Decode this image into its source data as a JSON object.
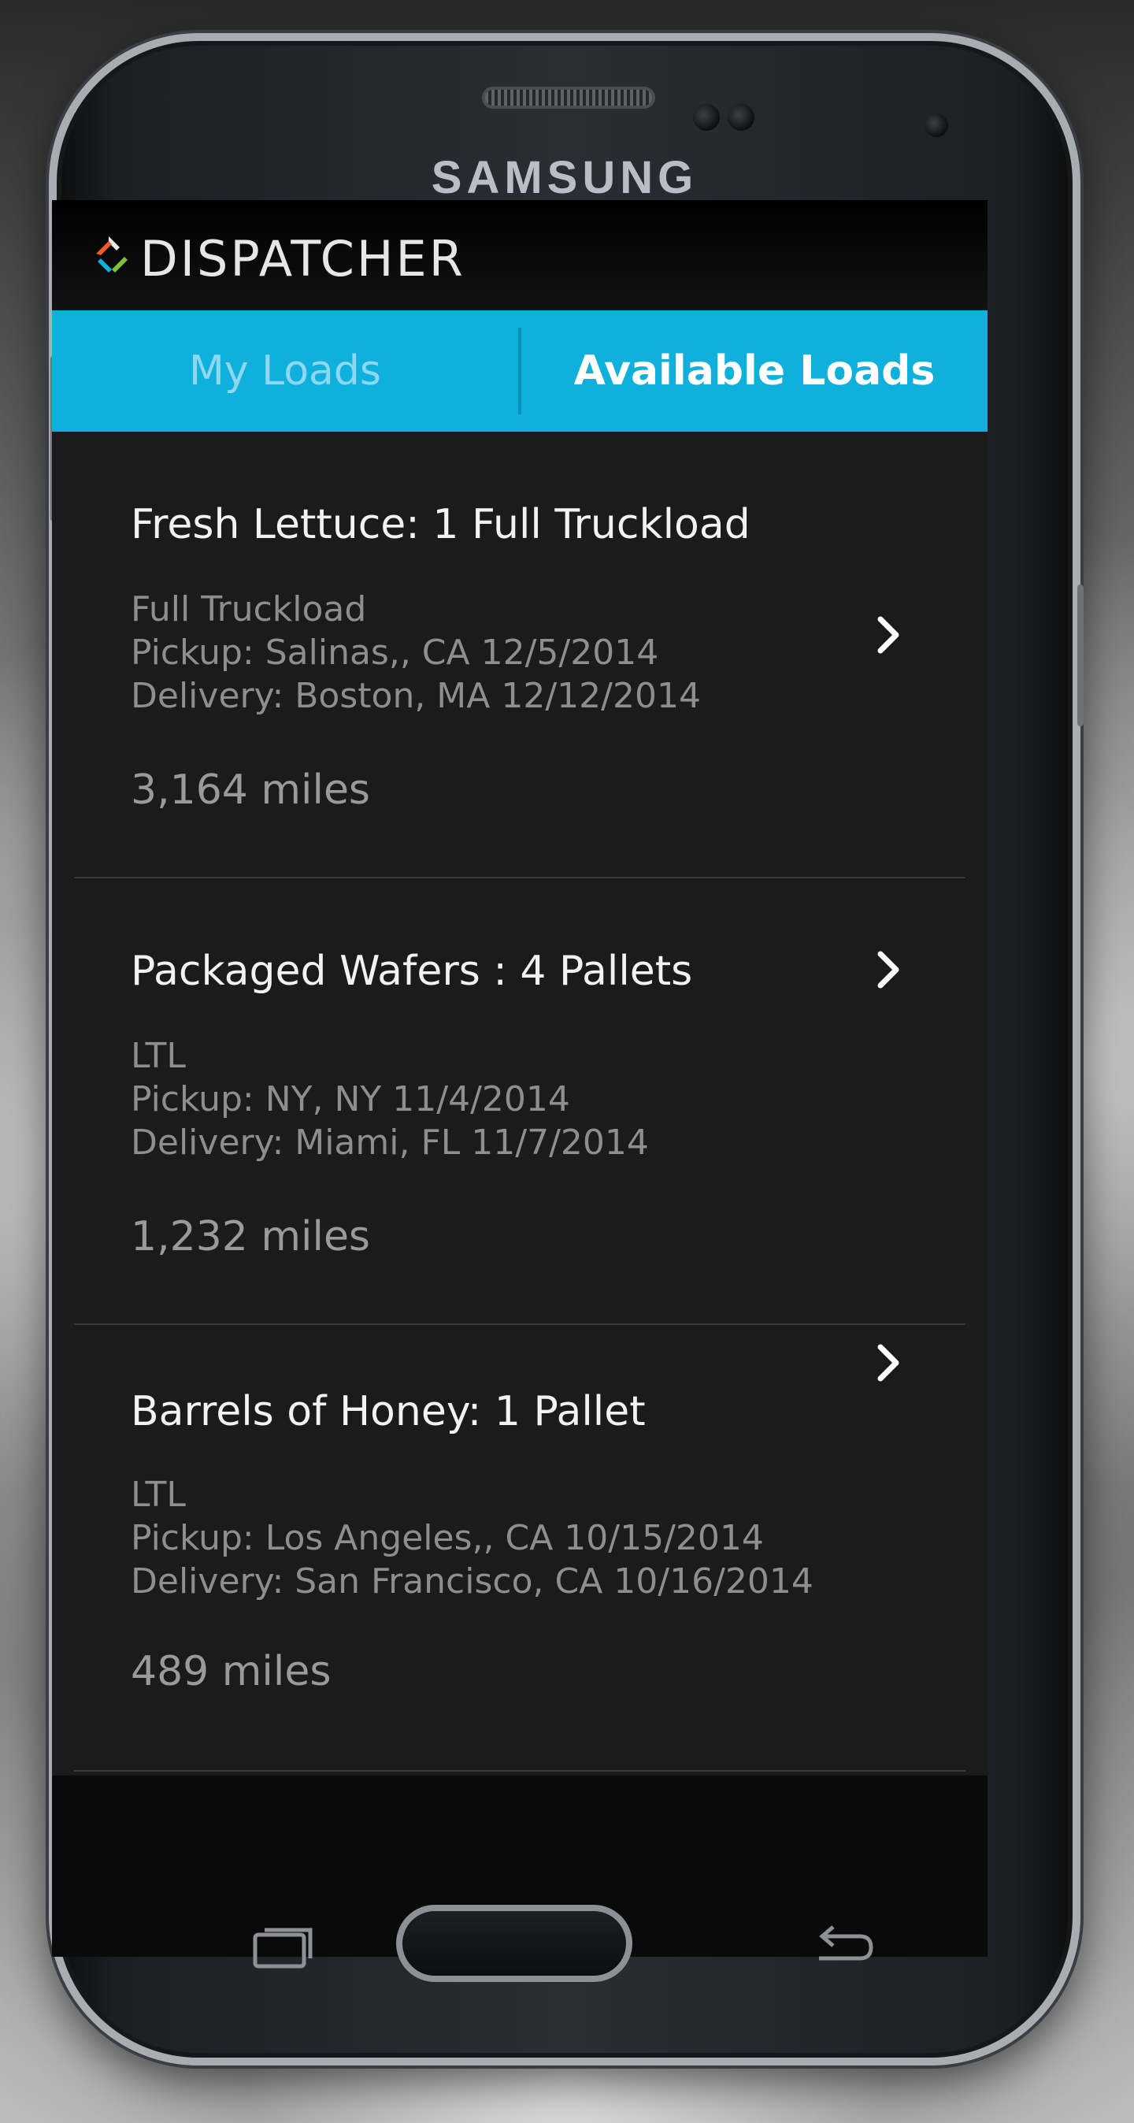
{
  "device": {
    "brand": "SAMSUNG"
  },
  "header": {
    "logo_text": "DISPATCHER",
    "logo_icon": "dispatcher-logo-icon"
  },
  "tabs": [
    {
      "label": "My Loads",
      "active": false
    },
    {
      "label": "Available Loads",
      "active": true
    }
  ],
  "loads": [
    {
      "title": "Fresh Lettuce: 1 Full Truckload",
      "type": "Full Truckload",
      "pickup": "Pickup: Salinas,, CA  12/5/2014",
      "delivery": "Delivery:  Boston, MA  12/12/2014",
      "miles": "3,164 miles"
    },
    {
      "title": "Packaged Wafers : 4 Pallets",
      "type": "LTL",
      "pickup": "Pickup: NY, NY  11/4/2014",
      "delivery": "Delivery: Miami, FL  11/7/2014",
      "miles": "1,232 miles"
    },
    {
      "title": "Barrels of Honey: 1 Pallet",
      "type": "LTL",
      "pickup": "Pickup: Los Angeles,, CA  10/15/2014",
      "delivery": "Delivery: San Francisco, CA  10/16/2014",
      "miles": "489 miles"
    }
  ],
  "nav_icons": [
    "recent-apps-icon",
    "home-button",
    "back-icon"
  ],
  "colors": {
    "accent": "#0fb0dc",
    "background": "#1b1b1b"
  }
}
